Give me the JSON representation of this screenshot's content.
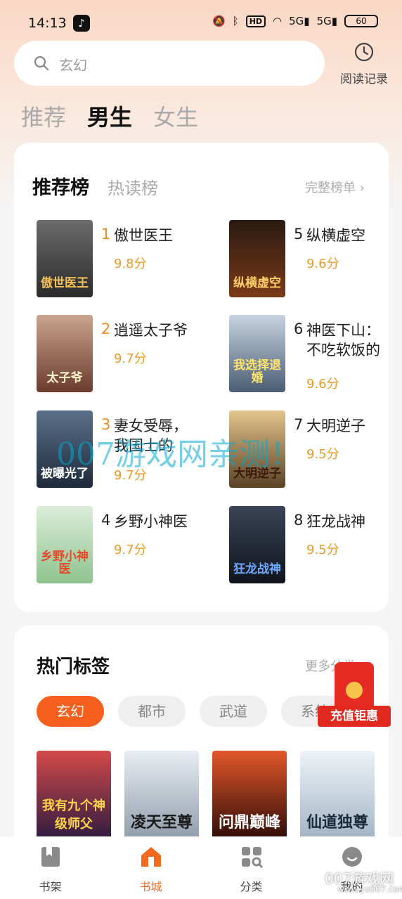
{
  "status_bar": {
    "time": "14:13",
    "icons": [
      "tiktok-icon",
      "mute-icon",
      "bluetooth-icon",
      "hd-icon",
      "wifi-icon",
      "signal-5g-icon",
      "signal-5g-icon",
      "battery-icon"
    ],
    "hd": "HD",
    "signal1": "5G",
    "signal2": "5G",
    "battery": "60"
  },
  "search": {
    "placeholder": "玄幻"
  },
  "history": {
    "label": "阅读记录"
  },
  "gender_tabs": [
    {
      "label": "推荐",
      "active": false
    },
    {
      "label": "男生",
      "active": true
    },
    {
      "label": "女生",
      "active": false
    }
  ],
  "ranking": {
    "tabs": [
      {
        "label": "推荐榜",
        "active": true
      },
      {
        "label": "热读榜",
        "active": false
      }
    ],
    "full_list": "完整榜单 ›",
    "books": [
      {
        "rank": "1",
        "title": "傲世医王",
        "score": "9.8分",
        "cover_text": "傲世医王",
        "cover_color": "#3a3a3a"
      },
      {
        "rank": "2",
        "title": "逍遥太子爷",
        "score": "9.7分",
        "cover_text": "太子爷",
        "cover_color": "#8a5a4a"
      },
      {
        "rank": "3",
        "title": "妻女受辱，我国士的身…",
        "score": "9.7分",
        "cover_text": "被曝光了",
        "cover_color": "#2c3f56"
      },
      {
        "rank": "4",
        "title": "乡野小神医",
        "score": "9.7分",
        "cover_text": "乡野小神医",
        "cover_color": "#6fae76"
      },
      {
        "rank": "5",
        "title": "纵横虚空",
        "score": "9.6分",
        "cover_text": "纵横虚空",
        "cover_color": "#3b2418"
      },
      {
        "rank": "6",
        "title": "神医下山：不吃软饭的",
        "score": "9.6分",
        "cover_text": "我选择退婚",
        "cover_color": "#5c6f86"
      },
      {
        "rank": "7",
        "title": "大明逆子",
        "score": "9.5分",
        "cover_text": "大明逆子",
        "cover_color": "#b28a4c"
      },
      {
        "rank": "8",
        "title": "狂龙战神",
        "score": "9.5分",
        "cover_text": "狂龙战神",
        "cover_color": "#1d2430"
      }
    ]
  },
  "hot_tags": {
    "title": "热门标签",
    "more": "更多分类 ›",
    "tags": [
      {
        "label": "玄幻",
        "active": true
      },
      {
        "label": "都市",
        "active": false
      },
      {
        "label": "武道",
        "active": false
      },
      {
        "label": "系统",
        "active": false
      }
    ],
    "covers": [
      {
        "text": "我有九个神级师父",
        "color": "#3a2a55"
      },
      {
        "text": "凌天至尊",
        "color": "#b9c4cf"
      },
      {
        "text": "问鼎巅峰",
        "color": "#5a1a12"
      },
      {
        "text": "仙道独尊",
        "color": "#c8d6e2"
      }
    ]
  },
  "promo": {
    "label": "充值钜惠"
  },
  "bottom_nav": [
    {
      "label": "书架",
      "icon": "bookshelf-icon",
      "active": false
    },
    {
      "label": "书城",
      "icon": "bookstore-icon",
      "active": true
    },
    {
      "label": "分类",
      "icon": "category-icon",
      "active": false
    },
    {
      "label": "我的",
      "icon": "profile-icon",
      "active": false
    }
  ],
  "watermark": "007游戏网亲测！",
  "corner_watermark": "007游戏网",
  "corner_watermark_url": "www.yx007.com"
}
